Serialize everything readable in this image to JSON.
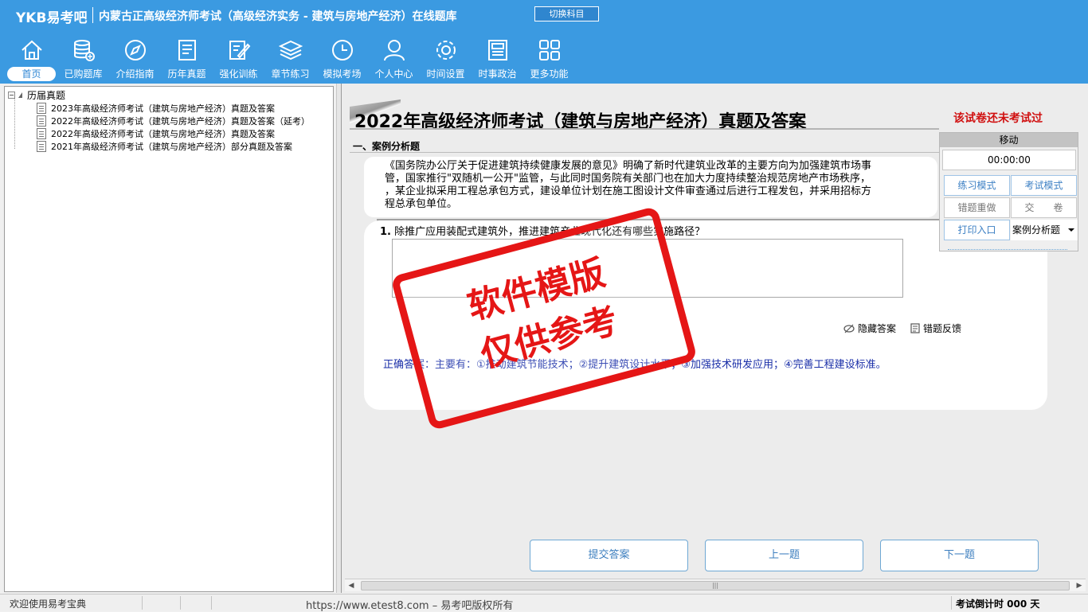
{
  "header": {
    "logo": "YKB易考吧",
    "title": "内蒙古正高级经济师考试（高级经济实务 - 建筑与房地产经济）在线题库",
    "switch_label": "切换科目"
  },
  "nav": [
    {
      "label": "首页",
      "icon": "home-icon",
      "active": true
    },
    {
      "label": "已购题库",
      "icon": "database-icon"
    },
    {
      "label": "介绍指南",
      "icon": "compass-icon"
    },
    {
      "label": "历年真题",
      "icon": "list-icon"
    },
    {
      "label": "强化训练",
      "icon": "edit-icon"
    },
    {
      "label": "章节练习",
      "icon": "layers-icon"
    },
    {
      "label": "模拟考场",
      "icon": "clock-icon"
    },
    {
      "label": "个人中心",
      "icon": "user-icon"
    },
    {
      "label": "时间设置",
      "icon": "gear-icon"
    },
    {
      "label": "时事政治",
      "icon": "newspaper-icon"
    },
    {
      "label": "更多功能",
      "icon": "grid-icon"
    }
  ],
  "tree": {
    "root": "历届真题",
    "items": [
      "2023年高级经济师考试（建筑与房地产经济）真题及答案",
      "2022年高级经济师考试（建筑与房地产经济）真题及答案（延考）",
      "2022年高级经济师考试（建筑与房地产经济）真题及答案",
      "2021年高级经济师考试（建筑与房地产经济）部分真题及答案"
    ]
  },
  "exam": {
    "title": "2022年高级经济师考试（建筑与房地产经济）真题及答案",
    "status": "该试卷还未考试过",
    "section": "一、案例分析题",
    "case_lines": [
      "《国务院办公厅关于促进建筑持续健康发展的意见》明确了新时代建筑业改革的主要方向为加强建筑市场事",
      "管，国家推行\"双随机一公开\"监管，与此同时国务院有关部门也在加大力度持续整治规范房地产市场秩序，",
      "，某企业拟采用工程总承包方式，建设单位计划在施工图设计文件审查通过后进行工程发包，并采用招标方",
      "程总承包单位。"
    ],
    "question_num": "1.",
    "question": "除推广应用装配式建筑外，推进建筑产业现代化还有哪些实施路径？",
    "hide_answer": "隐藏答案",
    "report_error": "错题反馈",
    "correct_answer": "正确答案：主要有：①推动建筑节能技术；②提升建筑设计水平；③加强技术研发应用；④完善工程建设标准。"
  },
  "stamp": {
    "line1": "软件模版",
    "line2": "仅供参考"
  },
  "buttons": {
    "submit": "提交答案",
    "prev": "上一题",
    "next": "下一题"
  },
  "panel": {
    "move": "移动",
    "timer": "00:00:00",
    "practice": "练习模式",
    "exam": "考试模式",
    "redo": "错题重做",
    "hand_in": "交　　卷",
    "print": "打印入口",
    "type": "案例分析题"
  },
  "status": {
    "welcome": "欢迎使用易考宝典",
    "url": "https://www.etest8.com – 易考吧版权所有",
    "countdown": "考试倒计时 000 天"
  }
}
